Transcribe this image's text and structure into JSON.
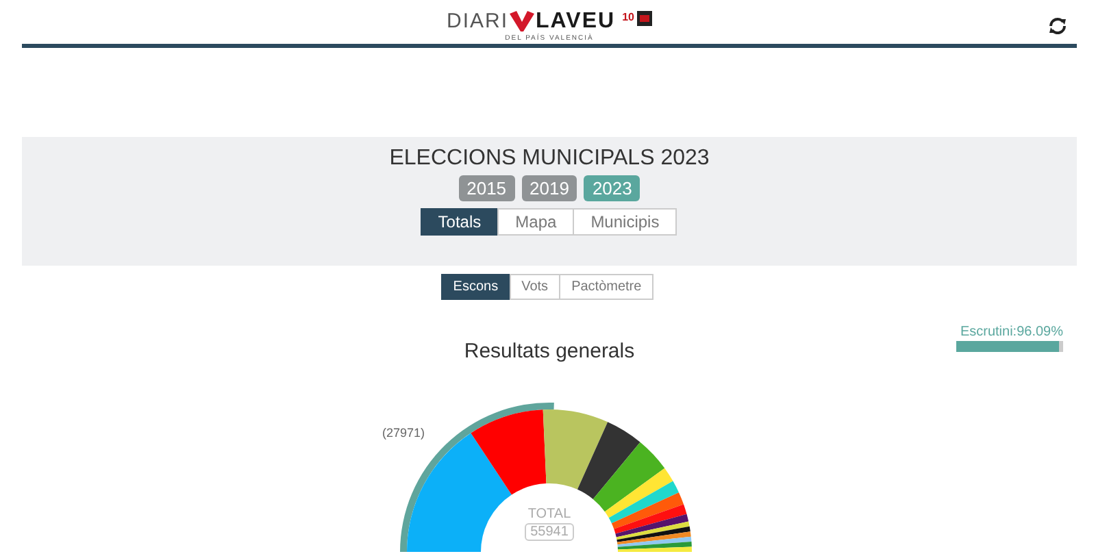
{
  "header": {
    "logo": {
      "left": "DIARI",
      "right": "LAVEU",
      "tagline": "DEL PAÍS VALENCIÀ",
      "badge": "10"
    }
  },
  "election": {
    "title": "ELECCIONS MUNICIPALS 2023",
    "years": [
      {
        "label": "2015",
        "selected": false
      },
      {
        "label": "2019",
        "selected": false
      },
      {
        "label": "2023",
        "selected": true
      }
    ],
    "tabs": [
      {
        "label": "Totals",
        "selected": true
      },
      {
        "label": "Mapa",
        "selected": false
      },
      {
        "label": "Municipis",
        "selected": false
      }
    ]
  },
  "view_tabs": [
    {
      "label": "Escons",
      "selected": true
    },
    {
      "label": "Vots",
      "selected": false
    },
    {
      "label": "Pactòmetre",
      "selected": false
    }
  ],
  "results": {
    "title": "Resultats generals",
    "majority": "(27971)",
    "total_label": "TOTAL",
    "total": "55941"
  },
  "count": {
    "label": "Escrutini:96.09%",
    "level": 0.9609
  }
}
